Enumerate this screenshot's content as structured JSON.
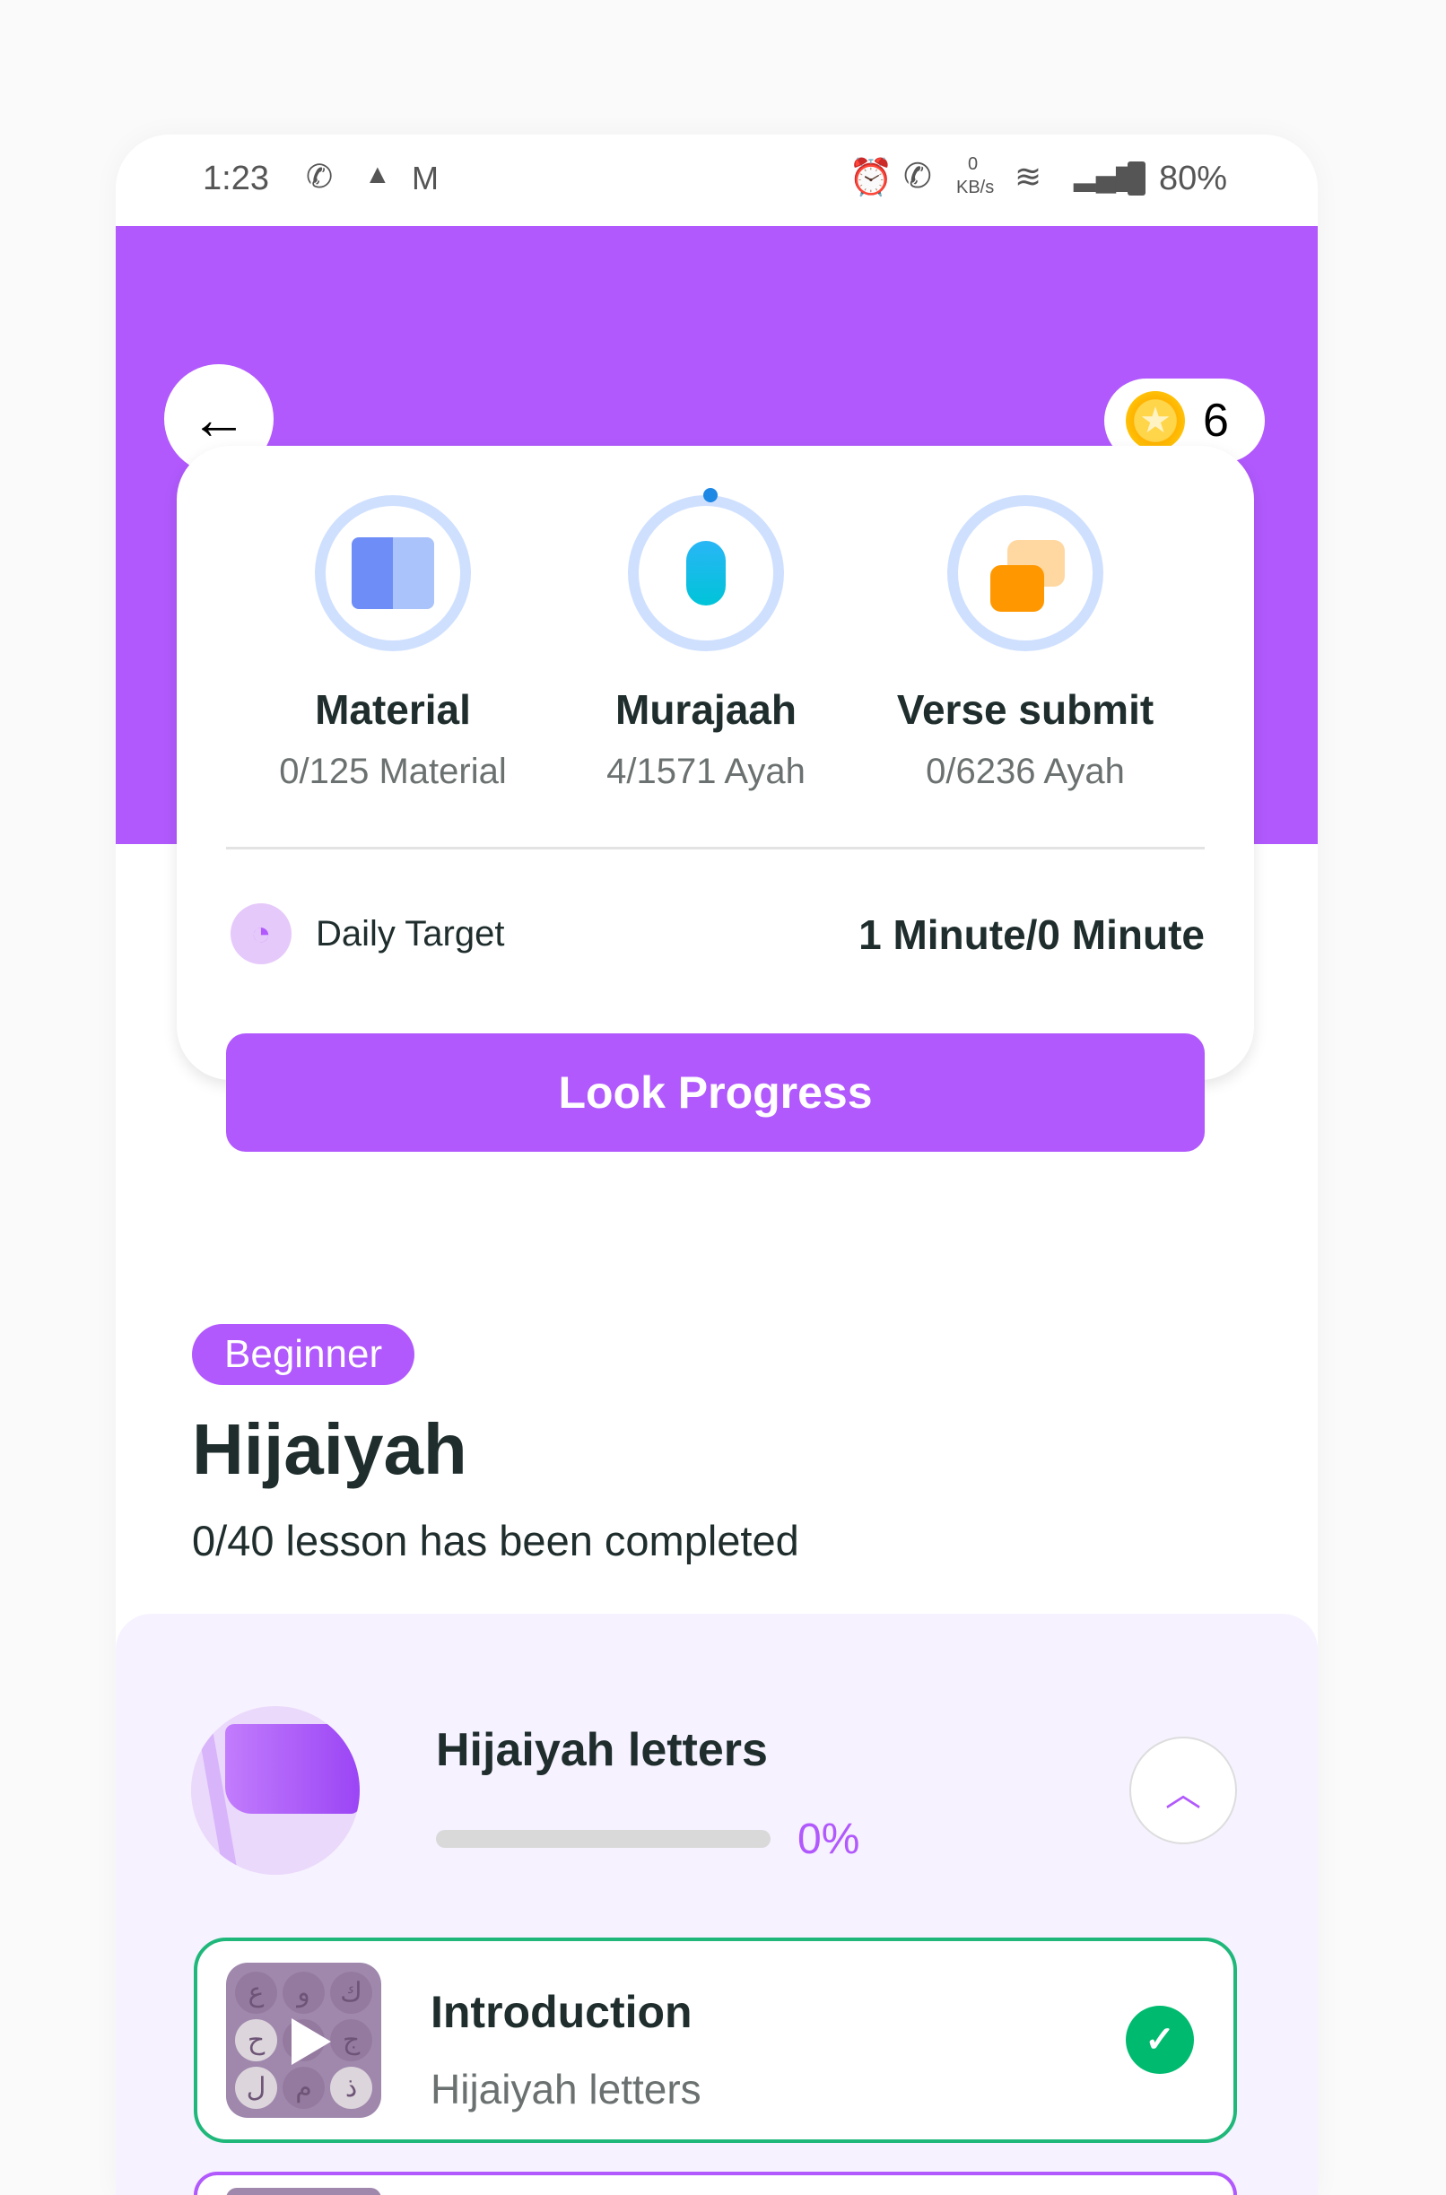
{
  "status_bar": {
    "time": "1:23",
    "net_speed_value": "0",
    "net_speed_unit": "KB/s",
    "battery": "80%"
  },
  "header": {
    "coins": "6"
  },
  "stats": [
    {
      "title": "Material",
      "subtitle": "0/125 Material",
      "icon": "book-icon"
    },
    {
      "title": "Murajaah",
      "subtitle": "4/1571 Ayah",
      "icon": "microphone-icon"
    },
    {
      "title": "Verse submit",
      "subtitle": "0/6236 Ayah",
      "icon": "chat-bubbles-icon"
    }
  ],
  "daily_target": {
    "label": "Daily Target",
    "value": "1 Minute/0 Minute"
  },
  "look_progress_label": "Look Progress",
  "course": {
    "level": "Beginner",
    "title": "Hijaiyah",
    "progress_text": "0/40 lesson has been completed"
  },
  "section": {
    "title": "Hijaiyah letters",
    "progress_percent": 0,
    "progress_label": "0%"
  },
  "lessons": [
    {
      "title": "Introduction",
      "subtitle": "Hijaiyah letters",
      "completed": true
    }
  ],
  "colors": {
    "accent": "#b159fd",
    "success": "#00bb6f",
    "section_bg": "#f6f2ff"
  }
}
